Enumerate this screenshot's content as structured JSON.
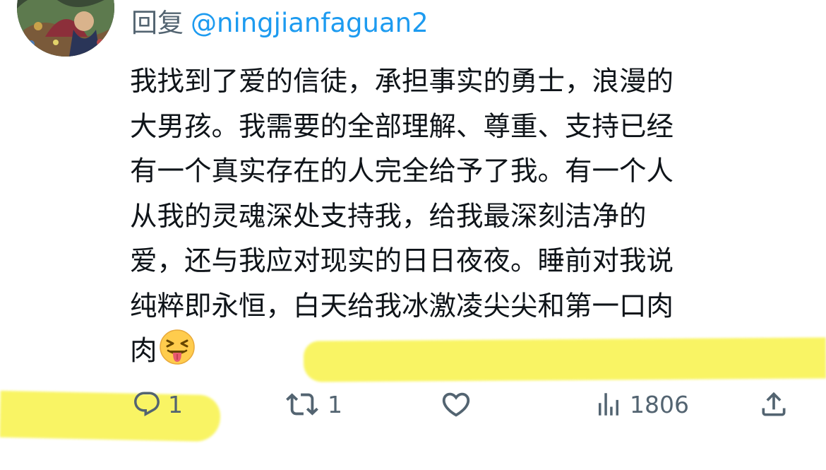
{
  "reply": {
    "prefix": "回复",
    "handle": "@ningjianfaguan2"
  },
  "tweet": {
    "lines": [
      "我找到了爱的信徒，承担事实的勇士，浪漫的",
      "大男孩。我需要的全部理解、尊重、支持已经",
      "有一个真实存在的人完全给予了我。有一个人",
      "从我的灵魂深处支持我，给我最深刻洁净的",
      "爱，还与我应对现实的日日夜夜。睡前对我说",
      "纯粹即永恒，白天给我冰激凌尖尖和第一口肉",
      "肉"
    ],
    "emoji": "squinting-face-with-tongue"
  },
  "actions": {
    "reply_count": "1",
    "retweet_count": "1",
    "like_count": "",
    "views_count": "1806"
  },
  "colors": {
    "text": "#0f1419",
    "secondary": "#536471",
    "link": "#1d9bf0",
    "highlight": "#f8f34a"
  }
}
